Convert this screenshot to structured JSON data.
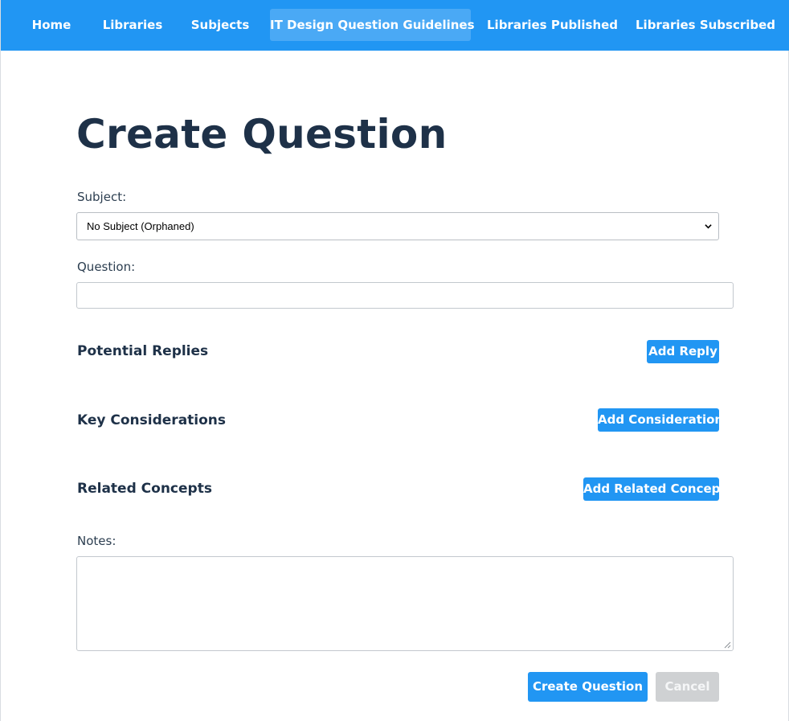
{
  "nav": {
    "items": [
      {
        "label": "Home"
      },
      {
        "label": "Libraries"
      },
      {
        "label": "Subjects"
      },
      {
        "label": "IT Design Question Guidelines"
      },
      {
        "label": "Libraries Published"
      },
      {
        "label": "Libraries Subscribed"
      }
    ],
    "active_index": 3
  },
  "page": {
    "title": "Create Question"
  },
  "form": {
    "subject_label": "Subject:",
    "subject_value": "No Subject (Orphaned)",
    "question_label": "Question:",
    "question_value": "",
    "notes_label": "Notes:",
    "notes_value": ""
  },
  "sections": {
    "replies": {
      "title": "Potential Replies",
      "button": "Add Reply"
    },
    "considerations": {
      "title": "Key Considerations",
      "button": "Add Consideration"
    },
    "concepts": {
      "title": "Related Concepts",
      "button": "Add Related Concept"
    }
  },
  "actions": {
    "create_label": "Create Question",
    "cancel_label": "Cancel"
  },
  "colors": {
    "primary": "#2196f3",
    "nav_active": "#4aa9f5",
    "heading": "#1e3148",
    "disabled": "#cfd1d3"
  }
}
